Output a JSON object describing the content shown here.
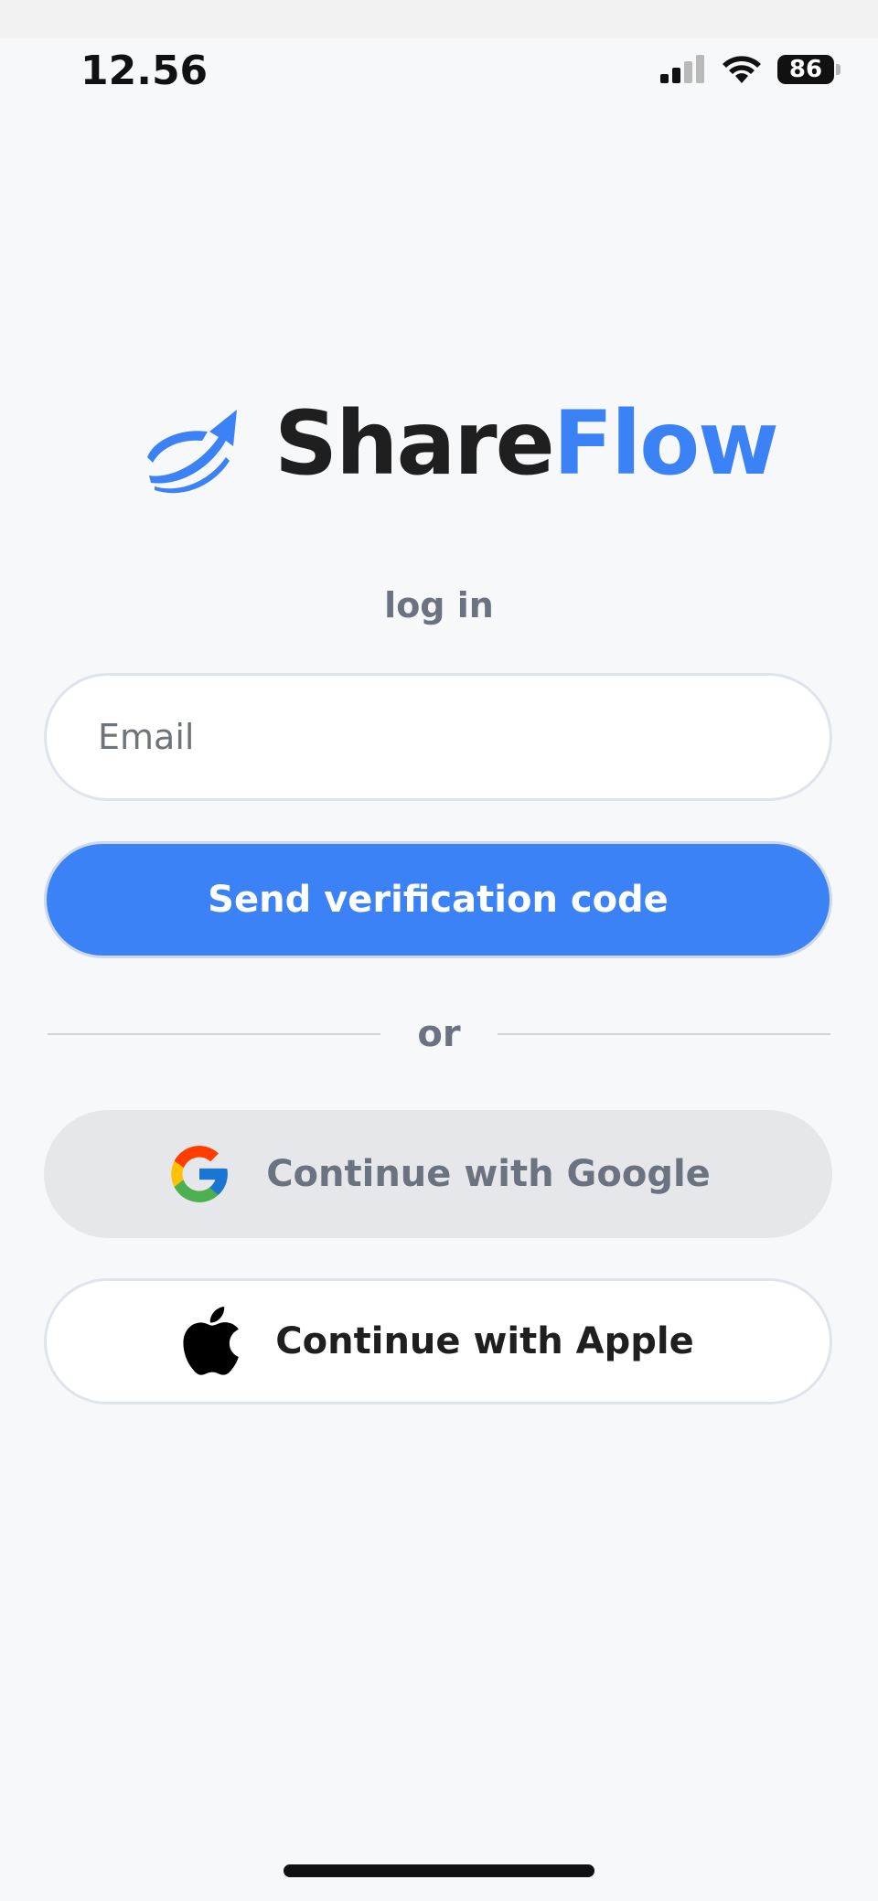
{
  "status_bar": {
    "time": "12.56",
    "battery": "86",
    "icons": [
      "signal-icon",
      "wifi-icon",
      "battery-icon"
    ]
  },
  "logo": {
    "part1": "Share",
    "part2": "Flow",
    "colors": {
      "dark": "#1f1f1f",
      "accent": "#3b82f6"
    }
  },
  "login": {
    "label": "log in",
    "email_placeholder": "Email",
    "email_value": "",
    "send_button": "Send verification code"
  },
  "divider": {
    "text": "or"
  },
  "social": {
    "google_label": "Continue with Google",
    "apple_label": "Continue with Apple"
  },
  "colors": {
    "primary": "#3b82f6",
    "background": "#f7f8fa",
    "muted_text": "#6b7280"
  }
}
